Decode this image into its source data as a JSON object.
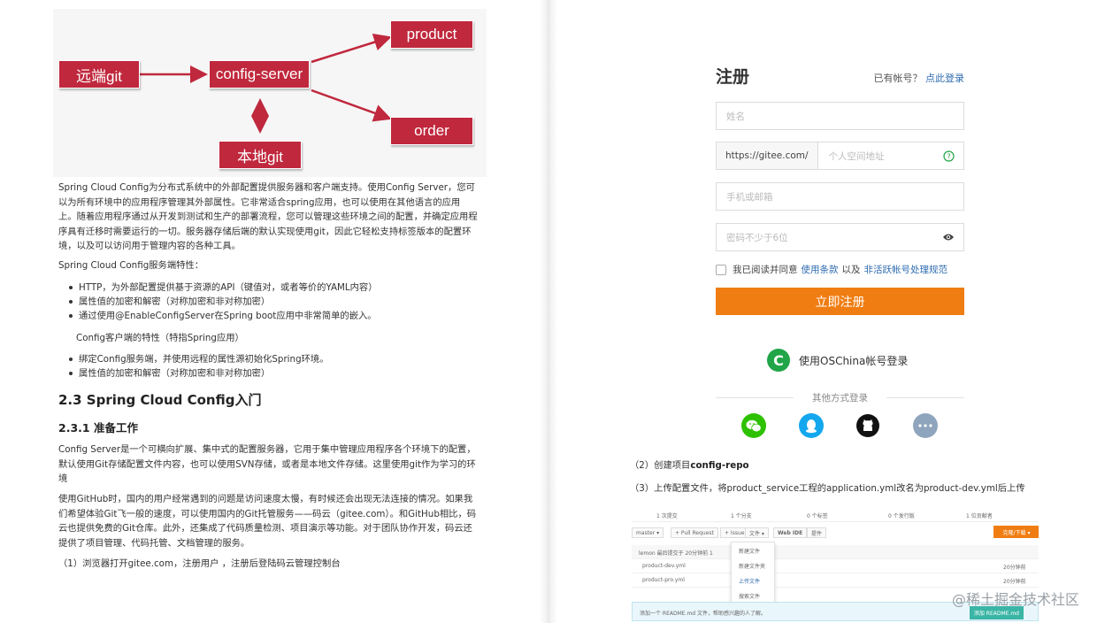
{
  "diagram": {
    "remote_git": "远端git",
    "config_server": "config-server",
    "product": "product",
    "order": "order",
    "local_git": "本地git"
  },
  "left": {
    "intro": "Spring Cloud Config为分布式系统中的外部配置提供服务器和客户端支持。使用Config Server，您可以为所有环境中的应用程序管理其外部属性。它非常适合spring应用，也可以使用在其他语言的应用上。随着应用程序通过从开发到测试和生产的部署流程，您可以管理这些环境之间的配置，并确定应用程序具有迁移时需要运行的一切。服务器存储后端的默认实现使用git，因此它轻松支持标签版本的配置环境，以及可以访问用于管理内容的各种工具。",
    "server_features_title": "Spring Cloud Config服务端特性：",
    "server_features": [
      "HTTP，为外部配置提供基于资源的API（键值对，或者等价的YAML内容）",
      "属性值的加密和解密（对称加密和非对称加密）",
      "通过使用@EnableConfigServer在Spring boot应用中非常简单的嵌入。"
    ],
    "client_features_title": "Config客户端的特性（特指Spring应用）",
    "client_features": [
      "绑定Config服务端，并使用远程的属性源初始化Spring环境。",
      "属性值的加密和解密（对称加密和非对称加密）"
    ],
    "h2": "2.3 Spring Cloud Config入门",
    "h3": "2.3.1 准备工作",
    "para1": "Config Server是一个可横向扩展、集中式的配置服务器，它用于集中管理应用程序各个环境下的配置，默认使用Git存储配置文件内容，也可以使用SVN存储，或者是本地文件存储。这里使用git作为学习的环境",
    "para2": "使用GitHub时，国内的用户经常遇到的问题是访问速度太慢，有时候还会出现无法连接的情况。如果我们希望体验Git飞一般的速度，可以使用国内的Git托管服务——码云（gitee.com）。和GitHub相比，码云也提供免费的Git仓库。此外，还集成了代码质量检测、项目演示等功能。对于团队协作开发，码云还提供了项目管理、代码托管、文档管理的服务。",
    "step1": "（1）浏览器打开gitee.com，注册用户 ，注册后登陆码云管理控制台"
  },
  "register": {
    "title": "注册",
    "has_account": "已有帐号？",
    "login_link": "点此登录",
    "name_placeholder": "姓名",
    "url_prefix": "https://gitee.com/",
    "space_placeholder": "个人空间地址",
    "phone_placeholder": "手机或邮箱",
    "password_placeholder": "密码不少于6位",
    "agree_text": "我已阅读并同意",
    "terms_link": "使用条款",
    "and_text": "以及",
    "policy_link": "非活跃帐号处理规范",
    "submit": "立即注册",
    "oschina_login": "使用OSChina帐号登录",
    "other_login": "其他方式登录"
  },
  "right": {
    "step2_prefix": "（2）创建项目",
    "step2_bold": "config-repo",
    "step3": "（3）上传配置文件，将product_service工程的application.yml改名为product-dev.yml后上传"
  },
  "mini": {
    "stats": [
      "1 次提交",
      "1 个分支",
      "0 个标签",
      "0 个发行版",
      "1 位贡献者"
    ],
    "tools": [
      "master ▾",
      "+ Pull Request",
      "+ Issue",
      "文件 ▾",
      "Web IDE",
      "提件"
    ],
    "download": "克隆/下载 ▾",
    "commit_row": "lemon 最后提交于 20分钟前 1",
    "files": [
      "product-dev.yml",
      "product-pro.yml"
    ],
    "times": [
      "20分钟前",
      "20分钟前"
    ],
    "menu": [
      "新建文件",
      "新建文件夹",
      "上传文件",
      "搜索文件"
    ],
    "readme_text": "添加一个 README.md 文件，帮助感兴趣的人了解。",
    "readme_btn": "添加 README.md"
  },
  "watermark": "@稀土掘金技术社区",
  "colors": {
    "diagram_box": "#c0283d",
    "orange": "#f07d12",
    "link": "#2e6bb0",
    "green": "#20a548"
  }
}
